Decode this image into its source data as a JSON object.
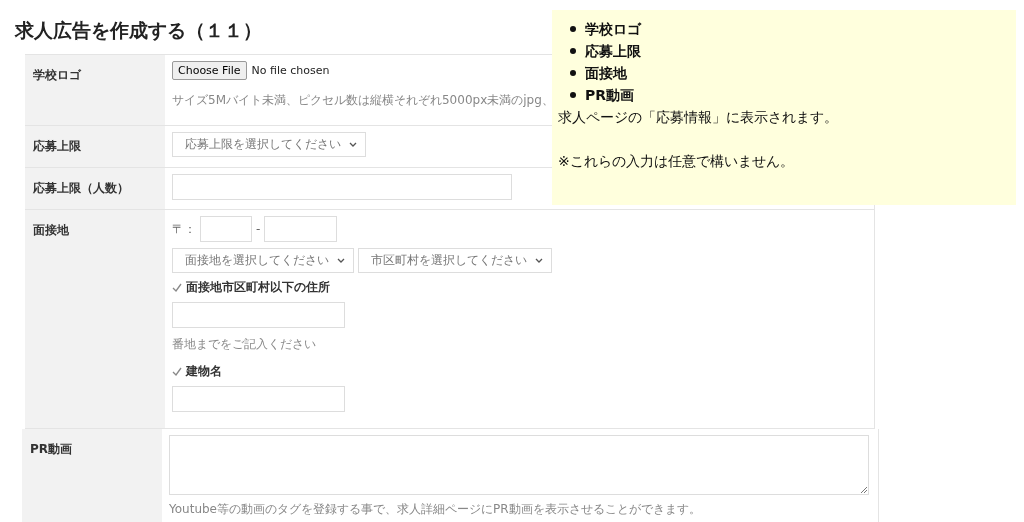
{
  "title": "求人広告を作成する（１１）",
  "form": {
    "rows": [
      {
        "kind": "file",
        "label": "学校ロゴ",
        "button": "Choose File",
        "status": "No file chosen",
        "hint": "サイズ5Mバイト未満、ピクセル数は縦横それぞれ5000px未満のjpg、"
      },
      {
        "kind": "select",
        "label": "応募上限",
        "placeholder": "応募上限を選択してください"
      },
      {
        "kind": "text",
        "label": "応募上限（人数）"
      },
      {
        "kind": "address",
        "label": "面接地",
        "postal_mark": "〒：",
        "postal_separator": "-",
        "selects": [
          "面接地を選択してください",
          "市区町村を選択してください"
        ],
        "fields": [
          {
            "label": "面接地市区町村以下の住所",
            "hint": "番地までをご記入ください"
          },
          {
            "label": "建物名"
          }
        ]
      },
      {
        "kind": "textarea",
        "label": "PR動画",
        "hint": "Youtube等の動画のタグを登録する事で、求人詳細ページにPR動画を表示させることができます。"
      }
    ]
  },
  "note": {
    "items": [
      "学校ロゴ",
      "応募上限",
      "面接地",
      "PR動画"
    ],
    "lines": [
      "求人ページの「応募情報」に表示されます。",
      "※これらの入力は任意で構いません。"
    ]
  }
}
